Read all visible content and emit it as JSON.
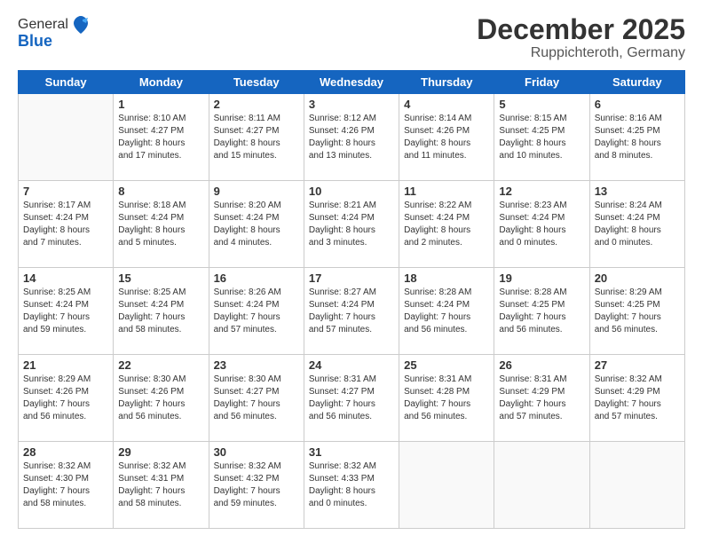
{
  "logo": {
    "general": "General",
    "blue": "Blue"
  },
  "header": {
    "month": "December 2025",
    "location": "Ruppichteroth, Germany"
  },
  "weekdays": [
    "Sunday",
    "Monday",
    "Tuesday",
    "Wednesday",
    "Thursday",
    "Friday",
    "Saturday"
  ],
  "weeks": [
    [
      {
        "day": "",
        "info": ""
      },
      {
        "day": "1",
        "info": "Sunrise: 8:10 AM\nSunset: 4:27 PM\nDaylight: 8 hours\nand 17 minutes."
      },
      {
        "day": "2",
        "info": "Sunrise: 8:11 AM\nSunset: 4:27 PM\nDaylight: 8 hours\nand 15 minutes."
      },
      {
        "day": "3",
        "info": "Sunrise: 8:12 AM\nSunset: 4:26 PM\nDaylight: 8 hours\nand 13 minutes."
      },
      {
        "day": "4",
        "info": "Sunrise: 8:14 AM\nSunset: 4:26 PM\nDaylight: 8 hours\nand 11 minutes."
      },
      {
        "day": "5",
        "info": "Sunrise: 8:15 AM\nSunset: 4:25 PM\nDaylight: 8 hours\nand 10 minutes."
      },
      {
        "day": "6",
        "info": "Sunrise: 8:16 AM\nSunset: 4:25 PM\nDaylight: 8 hours\nand 8 minutes."
      }
    ],
    [
      {
        "day": "7",
        "info": "Sunrise: 8:17 AM\nSunset: 4:24 PM\nDaylight: 8 hours\nand 7 minutes."
      },
      {
        "day": "8",
        "info": "Sunrise: 8:18 AM\nSunset: 4:24 PM\nDaylight: 8 hours\nand 5 minutes."
      },
      {
        "day": "9",
        "info": "Sunrise: 8:20 AM\nSunset: 4:24 PM\nDaylight: 8 hours\nand 4 minutes."
      },
      {
        "day": "10",
        "info": "Sunrise: 8:21 AM\nSunset: 4:24 PM\nDaylight: 8 hours\nand 3 minutes."
      },
      {
        "day": "11",
        "info": "Sunrise: 8:22 AM\nSunset: 4:24 PM\nDaylight: 8 hours\nand 2 minutes."
      },
      {
        "day": "12",
        "info": "Sunrise: 8:23 AM\nSunset: 4:24 PM\nDaylight: 8 hours\nand 0 minutes."
      },
      {
        "day": "13",
        "info": "Sunrise: 8:24 AM\nSunset: 4:24 PM\nDaylight: 8 hours\nand 0 minutes."
      }
    ],
    [
      {
        "day": "14",
        "info": "Sunrise: 8:25 AM\nSunset: 4:24 PM\nDaylight: 7 hours\nand 59 minutes."
      },
      {
        "day": "15",
        "info": "Sunrise: 8:25 AM\nSunset: 4:24 PM\nDaylight: 7 hours\nand 58 minutes."
      },
      {
        "day": "16",
        "info": "Sunrise: 8:26 AM\nSunset: 4:24 PM\nDaylight: 7 hours\nand 57 minutes."
      },
      {
        "day": "17",
        "info": "Sunrise: 8:27 AM\nSunset: 4:24 PM\nDaylight: 7 hours\nand 57 minutes."
      },
      {
        "day": "18",
        "info": "Sunrise: 8:28 AM\nSunset: 4:24 PM\nDaylight: 7 hours\nand 56 minutes."
      },
      {
        "day": "19",
        "info": "Sunrise: 8:28 AM\nSunset: 4:25 PM\nDaylight: 7 hours\nand 56 minutes."
      },
      {
        "day": "20",
        "info": "Sunrise: 8:29 AM\nSunset: 4:25 PM\nDaylight: 7 hours\nand 56 minutes."
      }
    ],
    [
      {
        "day": "21",
        "info": "Sunrise: 8:29 AM\nSunset: 4:26 PM\nDaylight: 7 hours\nand 56 minutes."
      },
      {
        "day": "22",
        "info": "Sunrise: 8:30 AM\nSunset: 4:26 PM\nDaylight: 7 hours\nand 56 minutes."
      },
      {
        "day": "23",
        "info": "Sunrise: 8:30 AM\nSunset: 4:27 PM\nDaylight: 7 hours\nand 56 minutes."
      },
      {
        "day": "24",
        "info": "Sunrise: 8:31 AM\nSunset: 4:27 PM\nDaylight: 7 hours\nand 56 minutes."
      },
      {
        "day": "25",
        "info": "Sunrise: 8:31 AM\nSunset: 4:28 PM\nDaylight: 7 hours\nand 56 minutes."
      },
      {
        "day": "26",
        "info": "Sunrise: 8:31 AM\nSunset: 4:29 PM\nDaylight: 7 hours\nand 57 minutes."
      },
      {
        "day": "27",
        "info": "Sunrise: 8:32 AM\nSunset: 4:29 PM\nDaylight: 7 hours\nand 57 minutes."
      }
    ],
    [
      {
        "day": "28",
        "info": "Sunrise: 8:32 AM\nSunset: 4:30 PM\nDaylight: 7 hours\nand 58 minutes."
      },
      {
        "day": "29",
        "info": "Sunrise: 8:32 AM\nSunset: 4:31 PM\nDaylight: 7 hours\nand 58 minutes."
      },
      {
        "day": "30",
        "info": "Sunrise: 8:32 AM\nSunset: 4:32 PM\nDaylight: 7 hours\nand 59 minutes."
      },
      {
        "day": "31",
        "info": "Sunrise: 8:32 AM\nSunset: 4:33 PM\nDaylight: 8 hours\nand 0 minutes."
      },
      {
        "day": "",
        "info": ""
      },
      {
        "day": "",
        "info": ""
      },
      {
        "day": "",
        "info": ""
      }
    ]
  ]
}
